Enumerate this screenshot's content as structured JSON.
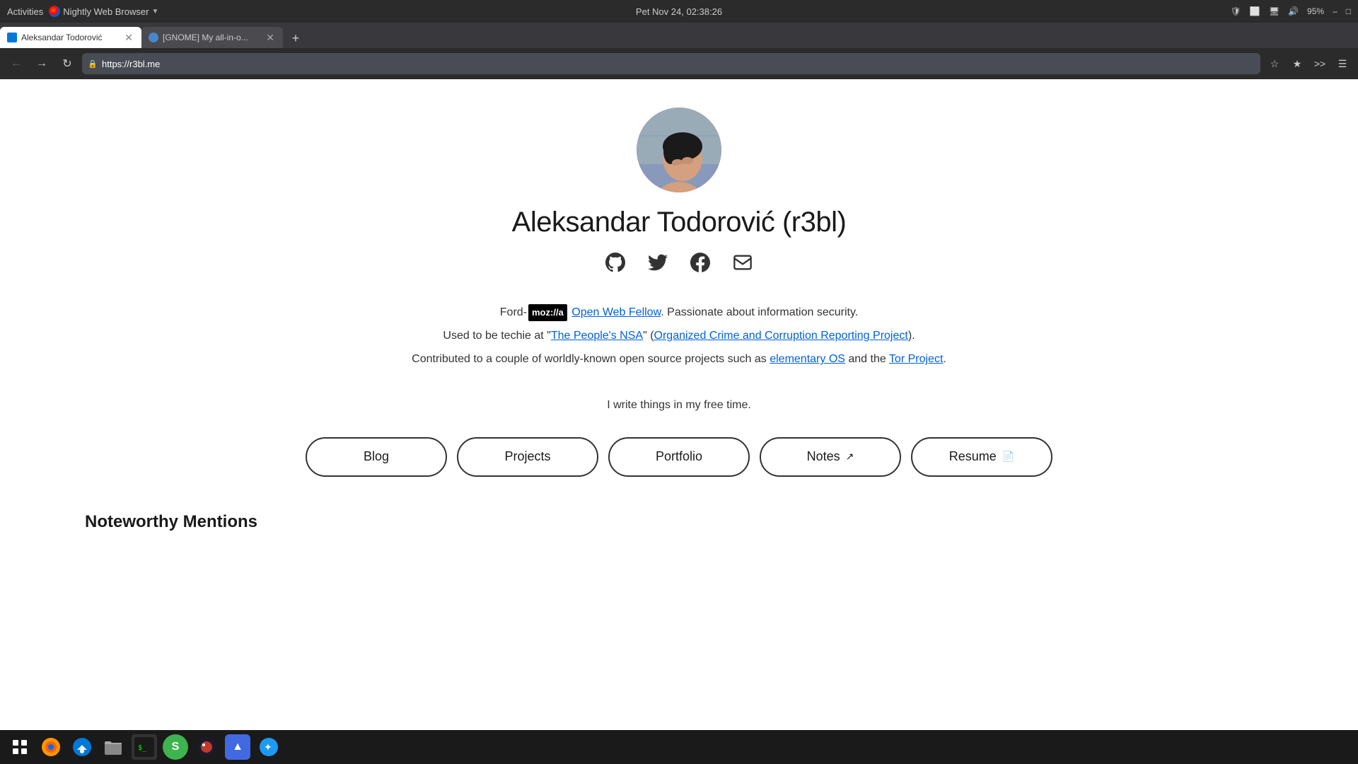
{
  "titlebar": {
    "activities": "Activities",
    "browser_name": "Nightly Web Browser",
    "datetime": "Pet Nov 24, 02:38:26",
    "battery": "95%"
  },
  "tabs": [
    {
      "label": "Aleksandar Todorović",
      "active": true,
      "favicon_type": "blue"
    },
    {
      "label": "[GNOME] My all-in-o...",
      "active": false,
      "favicon_type": "gnome"
    }
  ],
  "new_tab_label": "+",
  "address_bar": {
    "url": "https://r3bl.me",
    "lock_icon": "🔒"
  },
  "page": {
    "profile_name": "Aleksandar Todorović (r3bl)",
    "bio_line1_before": "Ford-",
    "bio_mozilla": "moz://a",
    "bio_line1_link": "Open Web Fellow",
    "bio_line1_after": ". Passionate about information security.",
    "bio_line2_before": "Used to be techie at \"",
    "bio_line2_link1": "The People's NSA",
    "bio_line2_between": "\" (",
    "bio_line2_link2": "Organized Crime and Corruption Reporting Project",
    "bio_line2_after": ").",
    "bio_line3_before": "Contributed to a couple of worldly-known open source projects such as ",
    "bio_line3_link1": "elementary OS",
    "bio_line3_between": " and the ",
    "bio_line3_link2": "Tor Project",
    "bio_line3_after": ".",
    "free_time": "I write things in my free time.",
    "buttons": [
      {
        "label": "Blog",
        "icon": ""
      },
      {
        "label": "Projects",
        "icon": ""
      },
      {
        "label": "Portfolio",
        "icon": ""
      },
      {
        "label": "Notes",
        "icon": "↗"
      },
      {
        "label": "Resume",
        "icon": "📄"
      }
    ],
    "noteworthy_title": "Noteworthy Mentions"
  },
  "taskbar": {
    "apps": [
      {
        "name": "grid-app",
        "icon": "⊞",
        "color": "#fff"
      },
      {
        "name": "firefox-app",
        "icon": "🦊",
        "color": "#ff6600"
      },
      {
        "name": "thunderbird-app",
        "icon": "🐦",
        "color": "#0078d7"
      },
      {
        "name": "files-app",
        "icon": "📁",
        "color": "#888"
      },
      {
        "name": "terminal-app",
        "icon": "⬛",
        "color": "#333"
      },
      {
        "name": "simplenote-app",
        "icon": "S",
        "color": "#3eb34f"
      },
      {
        "name": "popcorntime-app",
        "icon": "🍿",
        "color": "#333"
      },
      {
        "name": "affinity-app",
        "icon": "▲",
        "color": "#4169e1"
      },
      {
        "name": "kde-app",
        "icon": "✦",
        "color": "#1d99f3"
      }
    ]
  }
}
